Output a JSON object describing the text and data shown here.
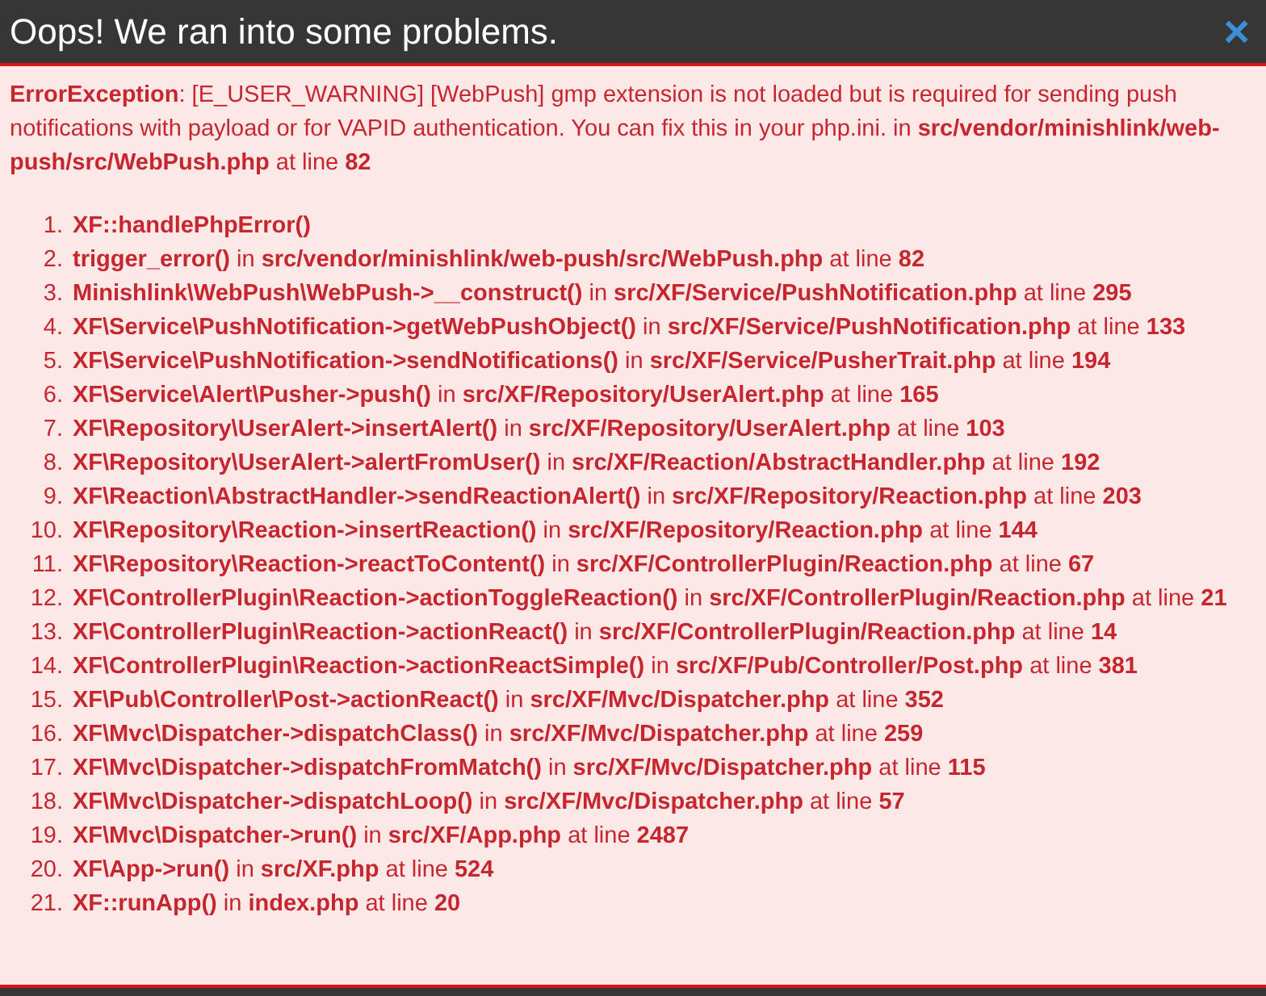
{
  "dialog": {
    "title": "Oops! We ran into some problems.",
    "close": "×"
  },
  "error": "**ErrorException**: [E_USER_WARNING] [WebPush] gmp extension is not loaded but is required for sending push notifications with payload or for VAPID authentication. You can fix this in your php.ini. in **src/vendor/minishlink/web-push/src/WebPush.php** at line **82**",
  "trace": [
    {
      "number": "1.",
      "text": "**XF::handlePhpError()**"
    },
    {
      "number": "2.",
      "text": "**trigger_error()** in **src/vendor/minishlink/web-push/src/WebPush.php** at line **82**"
    },
    {
      "number": "3.",
      "text": "**Minishlink\\WebPush\\WebPush->__construct()** in **src/XF/Service/PushNotification.php** at line **295**"
    },
    {
      "number": "4.",
      "text": "**XF\\Service\\PushNotification->getWebPushObject()** in **src/XF/Service/PushNotification.php** at line **133**"
    },
    {
      "number": "5.",
      "text": "**XF\\Service\\PushNotification->sendNotifications()** in **src/XF/Service/PusherTrait.php** at line **194**"
    },
    {
      "number": "6.",
      "text": "**XF\\Service\\Alert\\Pusher->push()** in **src/XF/Repository/UserAlert.php** at line **165**"
    },
    {
      "number": "7.",
      "text": "**XF\\Repository\\UserAlert->insertAlert()** in **src/XF/Repository/UserAlert.php** at line **103**"
    },
    {
      "number": "8.",
      "text": "**XF\\Repository\\UserAlert->alertFromUser()** in **src/XF/Reaction/AbstractHandler.php** at line **192**"
    },
    {
      "number": "9.",
      "text": "**XF\\Reaction\\AbstractHandler->sendReactionAlert()** in **src/XF/Repository/Reaction.php** at line **203**"
    },
    {
      "number": "10.",
      "text": "**XF\\Repository\\Reaction->insertReaction()** in **src/XF/Repository/Reaction.php** at line **144**"
    },
    {
      "number": "11.",
      "text": "**XF\\Repository\\Reaction->reactToContent()** in **src/XF/ControllerPlugin/Reaction.php** at line **67**"
    },
    {
      "number": "12.",
      "text": "**XF\\ControllerPlugin\\Reaction->actionToggleReaction()** in **src/XF/ControllerPlugin/Reaction.php** at line **21**"
    },
    {
      "number": "13.",
      "text": "**XF\\ControllerPlugin\\Reaction->actionReact()** in **src/XF/ControllerPlugin/Reaction.php** at line **14**"
    },
    {
      "number": "14.",
      "text": "**XF\\ControllerPlugin\\Reaction->actionReactSimple()** in **src/XF/Pub/Controller/Post.php** at line **381**"
    },
    {
      "number": "15.",
      "text": "**XF\\Pub\\Controller\\Post->actionReact()** in **src/XF/Mvc/Dispatcher.php** at line **352**"
    },
    {
      "number": "16.",
      "text": "**XF\\Mvc\\Dispatcher->dispatchClass()** in **src/XF/Mvc/Dispatcher.php** at line **259**"
    },
    {
      "number": "17.",
      "text": "**XF\\Mvc\\Dispatcher->dispatchFromMatch()** in **src/XF/Mvc/Dispatcher.php** at line **115**"
    },
    {
      "number": "18.",
      "text": "**XF\\Mvc\\Dispatcher->dispatchLoop()** in **src/XF/Mvc/Dispatcher.php** at line **57**"
    },
    {
      "number": "19.",
      "text": "**XF\\Mvc\\Dispatcher->run()** in **src/XF/App.php** at line **2487**"
    },
    {
      "number": "20.",
      "text": "**XF\\App->run()** in **src/XF.php** at line **524**"
    },
    {
      "number": "21.",
      "text": "**XF::runApp()** in **index.php** at line **20**"
    }
  ]
}
